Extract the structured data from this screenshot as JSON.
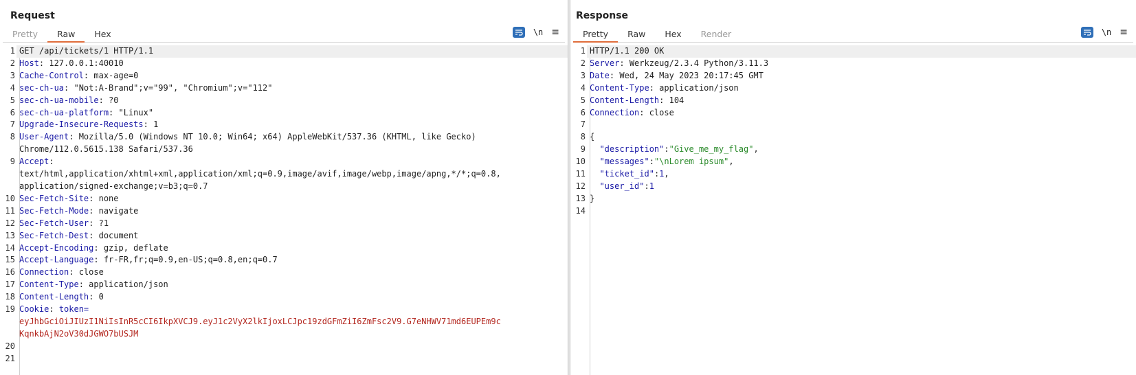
{
  "request": {
    "title": "Request",
    "tabs": [
      "Pretty",
      "Raw",
      "Hex"
    ],
    "active_tab": 1,
    "tool_newline": "\\n",
    "lines": [
      {
        "n": "1",
        "key": "",
        "sep": "",
        "val": "GET /api/tickets/1 HTTP/1.1"
      },
      {
        "n": "2",
        "key": "Host",
        "sep": ": ",
        "val": "127.0.0.1:40010"
      },
      {
        "n": "3",
        "key": "Cache-Control",
        "sep": ": ",
        "val": "max-age=0"
      },
      {
        "n": "4",
        "key": "sec-ch-ua",
        "sep": ": ",
        "val": "\"Not:A-Brand\";v=\"99\", \"Chromium\";v=\"112\""
      },
      {
        "n": "5",
        "key": "sec-ch-ua-mobile",
        "sep": ": ",
        "val": "?0"
      },
      {
        "n": "6",
        "key": "sec-ch-ua-platform",
        "sep": ": ",
        "val": "\"Linux\""
      },
      {
        "n": "7",
        "key": "Upgrade-Insecure-Requests",
        "sep": ": ",
        "val": "1"
      },
      {
        "n": "8",
        "key": "User-Agent",
        "sep": ": ",
        "val": "Mozilla/5.0 (Windows NT 10.0; Win64; x64) AppleWebKit/537.36 (KHTML, like Gecko)",
        "cont": "Chrome/112.0.5615.138 Safari/537.36"
      },
      {
        "n": "9",
        "key": "Accept",
        "sep": ":",
        "val": "",
        "cont": "text/html,application/xhtml+xml,application/xml;q=0.9,image/avif,image/webp,image/apng,*/*;q=0.8,",
        "cont2": "application/signed-exchange;v=b3;q=0.7"
      },
      {
        "n": "10",
        "key": "Sec-Fetch-Site",
        "sep": ": ",
        "val": "none"
      },
      {
        "n": "11",
        "key": "Sec-Fetch-Mode",
        "sep": ": ",
        "val": "navigate"
      },
      {
        "n": "12",
        "key": "Sec-Fetch-User",
        "sep": ": ",
        "val": "?1"
      },
      {
        "n": "13",
        "key": "Sec-Fetch-Dest",
        "sep": ": ",
        "val": "document"
      },
      {
        "n": "14",
        "key": "Accept-Encoding",
        "sep": ": ",
        "val": "gzip, deflate"
      },
      {
        "n": "15",
        "key": "Accept-Language",
        "sep": ": ",
        "val": "fr-FR,fr;q=0.9,en-US;q=0.8,en;q=0.7"
      },
      {
        "n": "16",
        "key": "Connection",
        "sep": ": ",
        "val": "close"
      },
      {
        "n": "17",
        "key": "Content-Type",
        "sep": ": ",
        "val": "application/json"
      },
      {
        "n": "18",
        "key": "Content-Length",
        "sep": ": ",
        "val": "0"
      },
      {
        "n": "19",
        "key": "Cookie",
        "sep": ": ",
        "cookie_name": "token=",
        "cont_red": "eyJhbGciOiJIUzI1NiIsInR5cCI6IkpXVCJ9.eyJ1c2VyX2lkIjoxLCJpc19zdGFmZiI6ZmFsc2V9.G7eNHWV71md6EUPEm9c",
        "cont_red2": "KqnkbAjN2oV30dJGWO7bUSJM"
      },
      {
        "n": "20",
        "key": "",
        "sep": "",
        "val": ""
      },
      {
        "n": "21",
        "key": "",
        "sep": "",
        "val": ""
      }
    ]
  },
  "response": {
    "title": "Response",
    "tabs": [
      "Pretty",
      "Raw",
      "Hex",
      "Render"
    ],
    "active_tab": 0,
    "tool_newline": "\\n",
    "headers": [
      {
        "n": "1",
        "key": "",
        "val": "HTTP/1.1 200 OK"
      },
      {
        "n": "2",
        "key": "Server",
        "val": "Werkzeug/2.3.4 Python/3.11.3"
      },
      {
        "n": "3",
        "key": "Date",
        "val": "Wed, 24 May 2023 20:17:45 GMT"
      },
      {
        "n": "4",
        "key": "Content-Type",
        "val": "application/json"
      },
      {
        "n": "5",
        "key": "Content-Length",
        "val": "104"
      },
      {
        "n": "6",
        "key": "Connection",
        "val": "close"
      },
      {
        "n": "7",
        "key": "",
        "val": ""
      }
    ],
    "json_lines": [
      {
        "n": "8",
        "text": "{"
      },
      {
        "n": "9",
        "jkey": "\"description\"",
        "jval": "\"Give_me_my_flag\"",
        "jtype": "str",
        "comma": ","
      },
      {
        "n": "10",
        "jkey": "\"messages\"",
        "jval": "\"\\nLorem ipsum\"",
        "jtype": "str",
        "comma": ","
      },
      {
        "n": "11",
        "jkey": "\"ticket_id\"",
        "jval": "1",
        "jtype": "num",
        "comma": ","
      },
      {
        "n": "12",
        "jkey": "\"user_id\"",
        "jval": "1",
        "jtype": "num",
        "comma": ""
      },
      {
        "n": "13",
        "text": "}"
      },
      {
        "n": "14",
        "text": ""
      }
    ]
  },
  "colors": {
    "accent": "#2f6fb8",
    "tab_underline": "#e06c3a",
    "header_key": "#1a1aa6",
    "token_red": "#b3261e",
    "json_string": "#2a8a2a"
  }
}
